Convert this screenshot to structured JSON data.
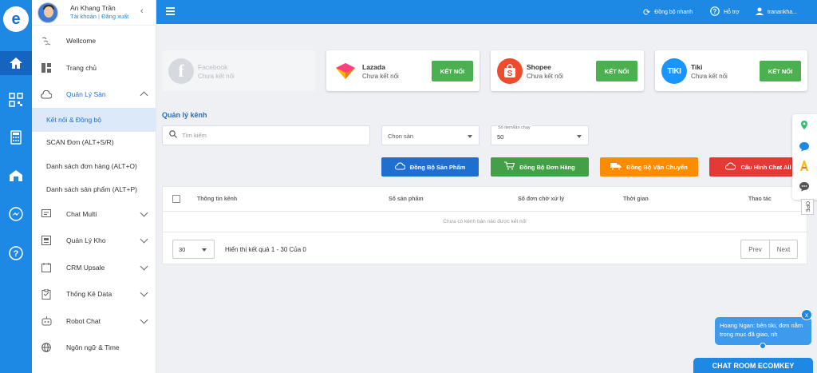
{
  "user": {
    "name": "An Khang Trần",
    "account_link": "Tài khoản",
    "separator": "|",
    "logout_link": "Đăng xuất"
  },
  "sidebar": {
    "items": [
      {
        "label": "Wellcome"
      },
      {
        "label": "Trang chủ"
      },
      {
        "label": "Quản Lý Sàn"
      },
      {
        "label": "Kết nối & Đồng bộ"
      },
      {
        "label": "SCAN Đơn (ALT+S/R)"
      },
      {
        "label": "Danh sách đơn hàng (ALT+O)"
      },
      {
        "label": "Danh sách sản phẩm (ALT+P)"
      },
      {
        "label": "Chat Multi"
      },
      {
        "label": "Quản Lý Kho"
      },
      {
        "label": "CRM Upsale"
      },
      {
        "label": "Thống Kê Data"
      },
      {
        "label": "Robot Chat"
      },
      {
        "label": "Ngôn ngữ & Time"
      }
    ]
  },
  "topbar": {
    "sync_label": "Đồng bộ nhanh",
    "help_label": "Hỗ trợ",
    "user_label": "tranankha..."
  },
  "channels": [
    {
      "name": "Facebook",
      "status": "Chưa kết nối"
    },
    {
      "name": "Lazada",
      "status": "Chưa kết nối",
      "button": "KẾT NỐI"
    },
    {
      "name": "Shopee",
      "status": "Chưa kết nối",
      "button": "KẾT NỐI"
    },
    {
      "name": "Tiki",
      "status": "Chưa kết nối",
      "button": "KẾT NỐI"
    }
  ],
  "logos": {
    "tiki": "TIKI"
  },
  "section": {
    "title": "Quản lý kênh"
  },
  "filters": {
    "search_placeholder": "Tìm kiếm",
    "marketplace_placeholder": "Chọn sàn",
    "items_label": "Số item/lần chạy",
    "items_value": "50"
  },
  "actions": [
    {
      "label": "Đồng Bộ Sản Phẩm",
      "color": "#1e6fd0"
    },
    {
      "label": "Đồng Bộ Đơn Hàng",
      "color": "#43a047"
    },
    {
      "label": "Đồng Bộ Vận Chuyển",
      "color": "#fb8c00"
    },
    {
      "label": "Cấu Hình Chat All",
      "color": "#e53935"
    }
  ],
  "table": {
    "columns": [
      "Thông tin kênh",
      "Số sản phẩm",
      "Số đơn chờ xử lý",
      "Thời gian",
      "Thao tác"
    ],
    "empty_text": "Chưa có kênh bán nào được kết nối",
    "page_size": "30",
    "result_info": "Hiển thị kết quả 1 - 30 Của 0",
    "prev": "Prev",
    "next": "Next"
  },
  "widget": {
    "ope_tab": "OPE",
    "close": "x"
  },
  "chat": {
    "bubble_text": "Hoang Ngan: bên tiki, đơn nằm trong mục đã giao, nh",
    "room_label": "CHAT ROOM ECOMKEY"
  },
  "colors": {
    "primary": "#1e88e5",
    "connect": "#4caf50",
    "lazada": "#f57224",
    "shopee": "#ee4d2d",
    "tiki": "#1a94ff"
  }
}
